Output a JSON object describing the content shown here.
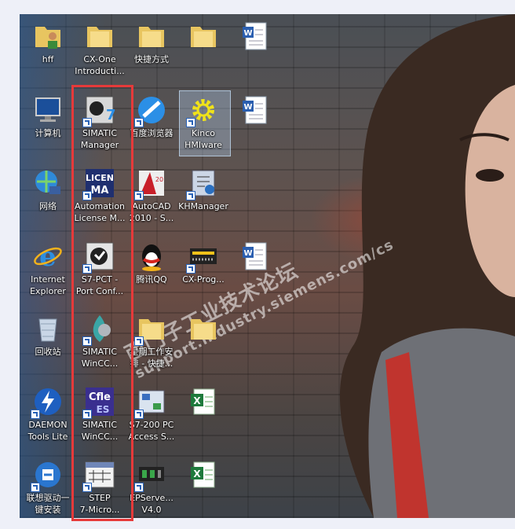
{
  "desktop": {
    "watermark_line1": "西门子工业技术论坛",
    "watermark_line2": "support.industry.siemens.com/cs",
    "icons": [
      {
        "id": "hff",
        "label": "hff",
        "icon": "user-folder-icon"
      },
      {
        "id": "cx-one",
        "label": "CX-One\nIntroducti...",
        "icon": "folder-icon"
      },
      {
        "id": "shortcut-folder",
        "label": "快捷方式",
        "icon": "folder-icon"
      },
      {
        "id": "blurred-folder",
        "label": "",
        "icon": "folder-icon"
      },
      {
        "id": "blurred-doc1",
        "label": "",
        "icon": "document-icon"
      },
      {
        "id": "computer",
        "label": "计算机",
        "icon": "computer-icon"
      },
      {
        "id": "simatic-manager",
        "label": "SIMATIC\nManager",
        "icon": "simatic-manager-icon"
      },
      {
        "id": "baidu-browser",
        "label": "百度浏览器",
        "icon": "browser-icon"
      },
      {
        "id": "kinco",
        "label": "Kinco\nHMIware",
        "icon": "gear-icon"
      },
      {
        "id": "blurred-doc2",
        "label": "",
        "icon": "document-icon"
      },
      {
        "id": "network",
        "label": "网络",
        "icon": "network-icon"
      },
      {
        "id": "automation-license",
        "label": "Automation\nLicense M...",
        "icon": "license-icon"
      },
      {
        "id": "autocad",
        "label": "AutoCAD\n2010 - S...",
        "icon": "autocad-icon"
      },
      {
        "id": "khmanager",
        "label": "KHManager",
        "icon": "khmanager-icon"
      },
      {
        "id": "ie",
        "label": "Internet\nExplorer",
        "icon": "ie-icon"
      },
      {
        "id": "s7-pct",
        "label": "S7-PCT -\nPort Conf...",
        "icon": "s7pct-icon"
      },
      {
        "id": "qq",
        "label": "腾讯QQ",
        "icon": "qq-icon"
      },
      {
        "id": "cx-prog",
        "label": "CX-Prog...",
        "icon": "plc-icon"
      },
      {
        "id": "blurred-doc3",
        "label": "",
        "icon": "document-icon"
      },
      {
        "id": "recycle-bin",
        "label": "回收站",
        "icon": "recycle-bin-icon"
      },
      {
        "id": "wincc1",
        "label": "SIMATIC\nWinCC...",
        "icon": "wincc-icon"
      },
      {
        "id": "schedule-folder",
        "label": "星期工作安\n排 - 快捷...",
        "icon": "folder-icon"
      },
      {
        "id": "blurred-folder2",
        "label": "",
        "icon": "folder-icon"
      },
      {
        "id": "daemon",
        "label": "DAEMON\nTools Lite",
        "icon": "daemon-icon"
      },
      {
        "id": "wincc-flex",
        "label": "SIMATIC\nWinCC...",
        "icon": "wincc-flexible-icon"
      },
      {
        "id": "s7-200-pc-access",
        "label": "S7-200 PC\nAccess S...",
        "icon": "pc-access-icon"
      },
      {
        "id": "blurred-excel1",
        "label": "",
        "icon": "excel-icon"
      },
      {
        "id": "lenovo-driver",
        "label": "联想驱动一\n键安装",
        "icon": "driver-icon"
      },
      {
        "id": "step7-micro",
        "label": "STEP\n7-Micro...",
        "icon": "step7-micro-icon"
      },
      {
        "id": "epserver",
        "label": "EPServe...\nV4.0",
        "icon": "epserver-icon"
      },
      {
        "id": "blurred-excel2",
        "label": "",
        "icon": "excel-icon"
      }
    ],
    "colors": {
      "highlight": "#e63a3a",
      "folder": "#e8c560",
      "label": "#ffffff"
    }
  }
}
